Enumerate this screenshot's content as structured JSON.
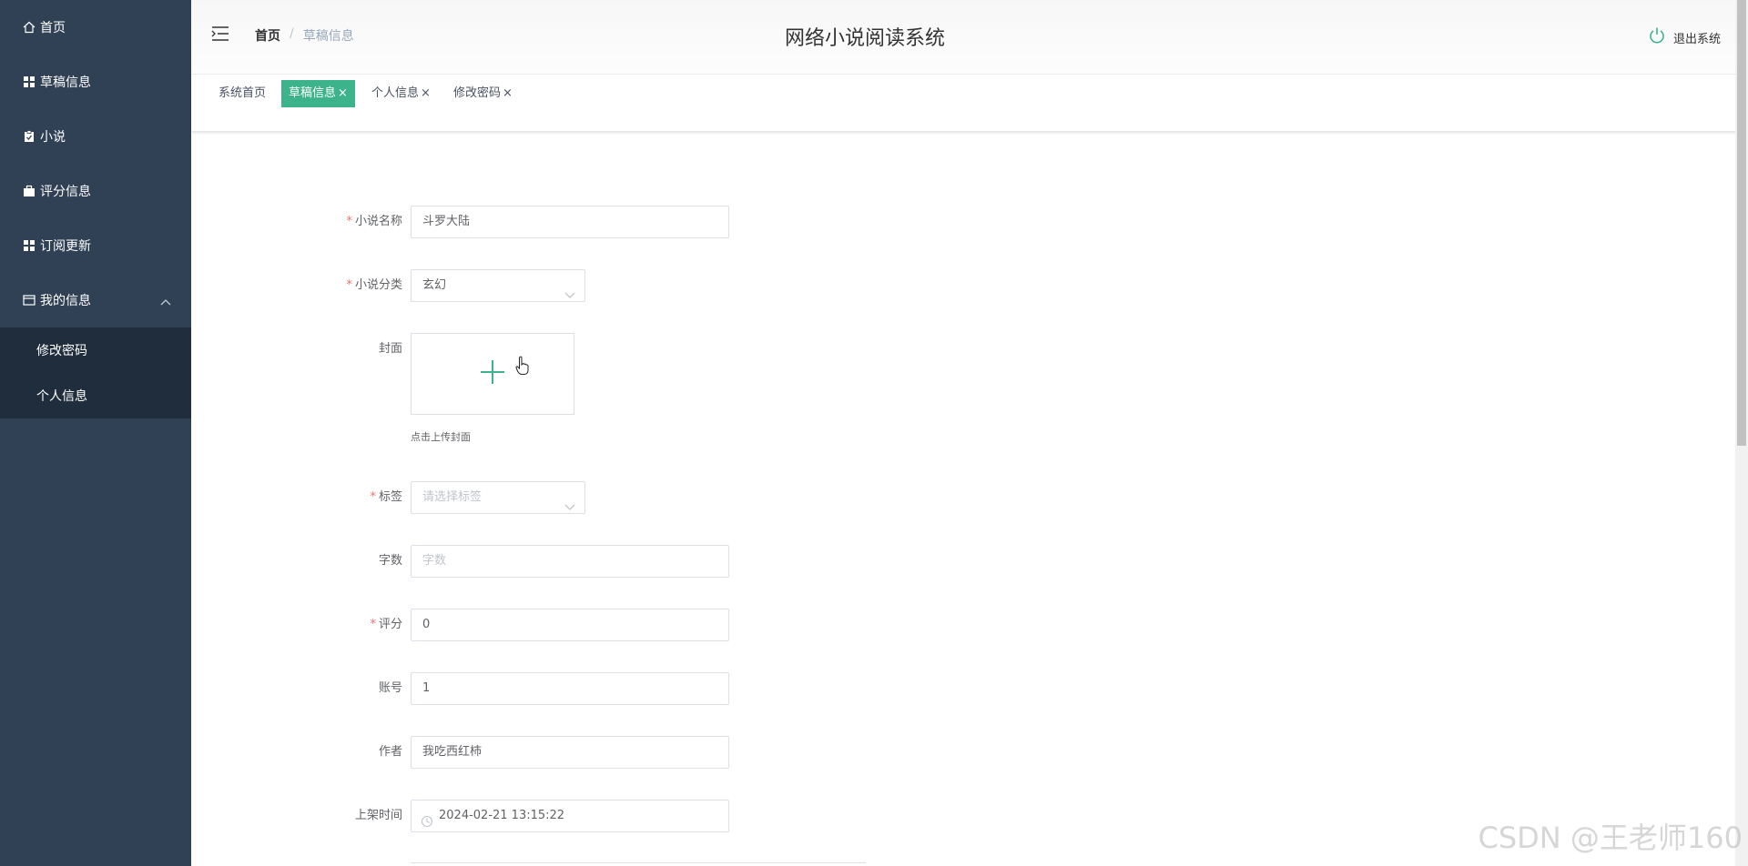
{
  "sidebar": {
    "items": [
      {
        "label": "首页",
        "icon": "home-icon"
      },
      {
        "label": "草稿信息",
        "icon": "grid-icon"
      },
      {
        "label": "小说",
        "icon": "clipboard-icon"
      },
      {
        "label": "评分信息",
        "icon": "briefcase-icon"
      },
      {
        "label": "订阅更新",
        "icon": "grid-icon"
      },
      {
        "label": "我的信息",
        "icon": "window-icon"
      }
    ],
    "submenu": [
      {
        "label": "修改密码"
      },
      {
        "label": "个人信息"
      }
    ]
  },
  "header": {
    "breadcrumb_home": "首页",
    "breadcrumb_sep": "/",
    "breadcrumb_current": "草稿信息",
    "title": "网络小说阅读系统",
    "logout_label": "退出系统"
  },
  "tags": [
    {
      "label": "系统首页",
      "closable": false,
      "active": false
    },
    {
      "label": "草稿信息",
      "closable": true,
      "active": true
    },
    {
      "label": "个人信息",
      "closable": true,
      "active": false
    },
    {
      "label": "修改密码",
      "closable": true,
      "active": false
    }
  ],
  "tag_close_glyph": "×",
  "form": {
    "novel_name": {
      "label": "小说名称",
      "required": true,
      "value": "斗罗大陆"
    },
    "category": {
      "label": "小说分类",
      "required": true,
      "value": "玄幻"
    },
    "cover": {
      "label": "封面",
      "hint": "点击上传封面"
    },
    "tags": {
      "label": "标签",
      "required": true,
      "placeholder": "请选择标签"
    },
    "word_count": {
      "label": "字数",
      "placeholder": "字数"
    },
    "score": {
      "label": "评分",
      "required": true,
      "value": "0"
    },
    "account": {
      "label": "账号",
      "value": "1"
    },
    "author": {
      "label": "作者",
      "value": "我吃西红柿"
    },
    "publish_time": {
      "label": "上架时间",
      "value": "2024-02-21 13:15:22"
    },
    "required_mark": "*"
  },
  "watermark": "CSDN @王老师160",
  "colors": {
    "sidebar_bg": "#304156",
    "submenu_bg": "#1f2d3d",
    "accent": "#3cb38a",
    "required": "#f56c6c"
  }
}
